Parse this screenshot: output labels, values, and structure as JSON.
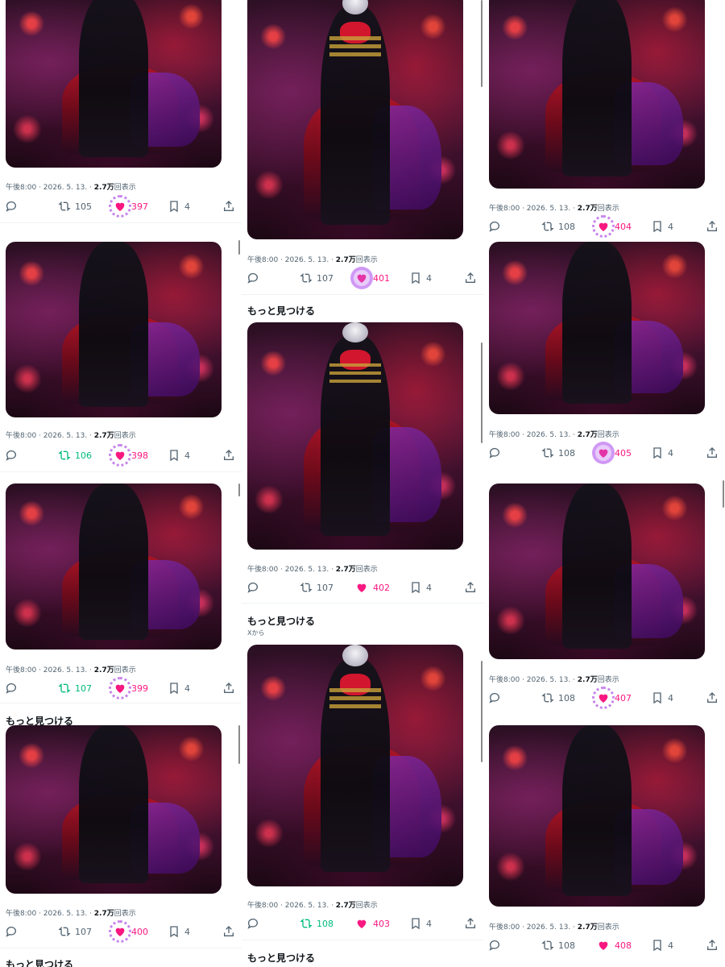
{
  "post": {
    "meta_prefix": "午後8:00 · 2026. 5. 13. · ",
    "views": "2.7万",
    "views_suffix": "回表示",
    "replies": "",
    "bookmarks": "4"
  },
  "section": {
    "more_heading": "もっと見つける",
    "from_x": "Xから"
  },
  "colors": {
    "like": "#f91880",
    "retweet_active": "#00ba7c",
    "muted": "#536471"
  },
  "icons": [
    "reply-icon",
    "retweet-icon",
    "heart-icon",
    "bookmark-icon",
    "share-icon"
  ],
  "columns": [
    {
      "frames": [
        {
          "retweets": "105",
          "likes": "397",
          "retweeted": false,
          "halo": "dotted"
        },
        {
          "retweets": "106",
          "likes": "398",
          "retweeted": true,
          "halo": "dotted"
        },
        {
          "retweets": "107",
          "likes": "399",
          "retweeted": true,
          "halo": "dotted"
        },
        {
          "retweets": "107",
          "likes": "400",
          "retweeted": false,
          "halo": "dotted"
        }
      ]
    },
    {
      "frames": [
        {
          "retweets": "107",
          "likes": "401",
          "retweeted": false,
          "halo": "solid"
        },
        {
          "retweets": "107",
          "likes": "402",
          "retweeted": false,
          "halo": "none"
        },
        {
          "retweets": "108",
          "likes": "403",
          "retweeted": true,
          "halo": "none"
        }
      ]
    },
    {
      "frames": [
        {
          "retweets": "108",
          "likes": "404",
          "retweeted": false,
          "halo": "dotted"
        },
        {
          "retweets": "108",
          "likes": "405",
          "retweeted": false,
          "halo": "solid"
        },
        {
          "retweets": "108",
          "likes": "407",
          "retweeted": false,
          "halo": "dotted"
        },
        {
          "retweets": "108",
          "likes": "408",
          "retweeted": false,
          "halo": "none"
        }
      ]
    }
  ]
}
